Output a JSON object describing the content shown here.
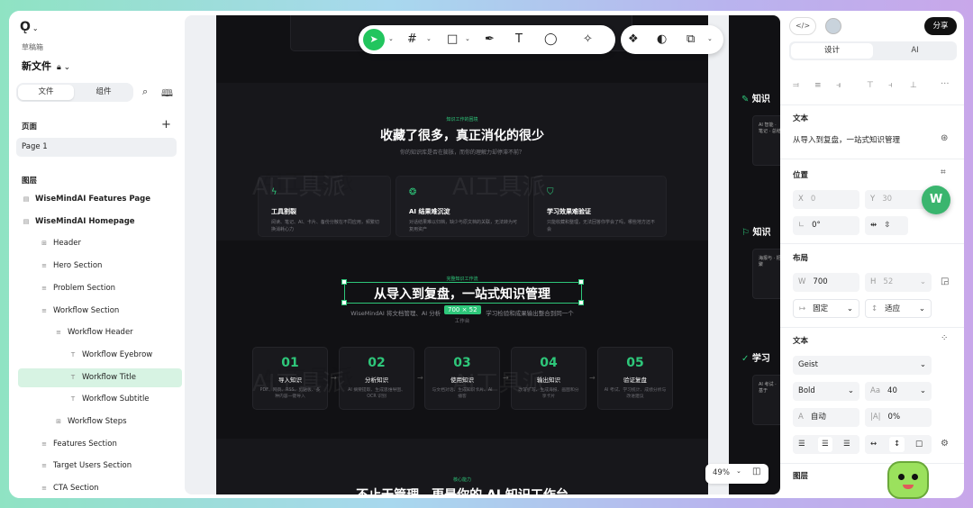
{
  "sidebar": {
    "logo": "Ǫ",
    "breadcrumb": "草稿箱",
    "file_name": "新文件",
    "tabs": [
      "文件",
      "组件"
    ],
    "pages_title": "页面",
    "page_item": "Page 1",
    "layers_title": "图层",
    "layers": [
      {
        "label": "WiseMindAI Features Page",
        "bold": true
      },
      {
        "label": "WiseMindAI Homepage",
        "bold": true
      },
      {
        "label": "Header"
      },
      {
        "label": "Hero Section"
      },
      {
        "label": "Problem Section"
      },
      {
        "label": "Workflow Section"
      },
      {
        "label": "Workflow Header"
      },
      {
        "label": "Workflow Eyebrow"
      },
      {
        "label": "Workflow Title",
        "selected": true
      },
      {
        "label": "Workflow Subtitle"
      },
      {
        "label": "Workflow Steps"
      },
      {
        "label": "Features Section"
      },
      {
        "label": "Target Users Section"
      },
      {
        "label": "CTA Section"
      }
    ]
  },
  "toolbar": {
    "icons": [
      "select-icon",
      "frame-icon",
      "rectangle-icon",
      "pen-icon",
      "text-icon",
      "comment-icon",
      "ai-icon",
      "component-icon",
      "contrast-icon",
      "boolean-icon"
    ]
  },
  "artboard": {
    "problem": {
      "eyebrow": "知识工作的困境",
      "title": "收藏了很多，真正消化的很少",
      "subtitle": "你的知识库是否在膨胀，而你的理解力却停滞不前？",
      "cards": [
        {
          "title": "工具割裂",
          "desc": "阅读、笔记、AI、卡片、备份分散在不同应用，频繁切换消耗心力"
        },
        {
          "title": "AI 结果难沉淀",
          "desc": "对话结果难以归档，缺少与原文档的关联，无法转为可复用资产"
        },
        {
          "title": "学习效果难验证",
          "desc": "只能收藏和整理，无法回答你学会了吗，哪些地方还不会"
        }
      ]
    },
    "workflow": {
      "eyebrow": "完整知识工作流",
      "title": "从导入到复盘，一站式知识管理",
      "subtitle_a": "WiseMindAI 将文档管理、AI 分析",
      "subtitle_b": "学习检验和成果输出整合到同一个",
      "subtitle_c": "工作台",
      "dim_badge": "700 × 52",
      "steps": [
        {
          "num": "01",
          "title": "导入知识",
          "desc": "PDF、网页、RSS、剪贴板、多种内容一键导入"
        },
        {
          "num": "02",
          "title": "分析知识",
          "desc": "AI 摘要提取、生成思维导图、OCR 识别"
        },
        {
          "num": "03",
          "title": "使用知识",
          "desc": "与文档对话、生成知识卡片、AI 播客"
        },
        {
          "num": "04",
          "title": "输出知识",
          "desc": "改写扩写、生成海报、画图和分享卡片"
        },
        {
          "num": "05",
          "title": "验证复盘",
          "desc": "AI 考试、学习统计、成绩分析与改进建议"
        }
      ]
    },
    "core": {
      "eyebrow": "核心能力",
      "title": "不止于管理，更是你的 AI 知识工作台"
    },
    "right_strip": [
      {
        "title": "知识",
        "desc": "AI 智能 · 笔记 · 总结"
      },
      {
        "title": "知识",
        "desc": "海报与 · 把聚"
      },
      {
        "title": "学习",
        "desc": "AI 考试 · 基于"
      }
    ],
    "watermark": "AI工具派"
  },
  "zoom": "49%",
  "right_panel": {
    "share": "分享",
    "tabs": [
      "设计",
      "AI"
    ],
    "text_title": "文本",
    "text_value": "从导入到复盘，一站式知识管理",
    "position_title": "位置",
    "x_label": "X",
    "x_value": "0",
    "y_label": "Y",
    "y_value": "30",
    "rotation": "0°",
    "layout_title": "布局",
    "w_label": "W",
    "w_value": "700",
    "h_label": "H",
    "h_value": "52",
    "width_mode": "固定",
    "height_mode": "适应",
    "typography_title": "文本",
    "font": "Geist",
    "weight": "Bold",
    "size_label": "Aa",
    "size": "40",
    "line_height": "自动",
    "letter_spacing": "0%",
    "layers_title": "图层",
    "badge": "W"
  }
}
